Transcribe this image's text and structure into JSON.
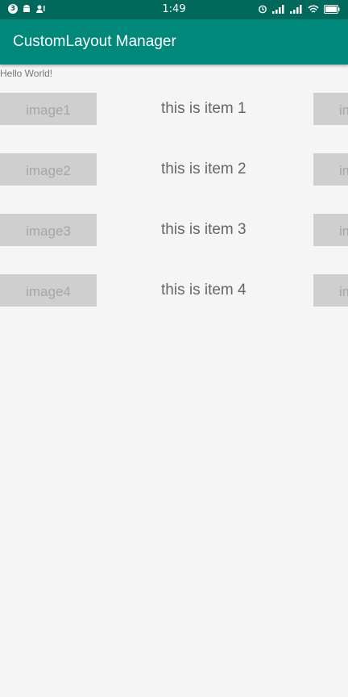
{
  "status_bar": {
    "notification_count": "3",
    "time": "1:49",
    "left_icons": [
      "android-icon",
      "person-icon"
    ],
    "right_icons": [
      "alarm-icon",
      "signal-icon",
      "signal-icon",
      "wifi-icon",
      "battery-icon"
    ]
  },
  "app_bar": {
    "title": "CustomLayout Manager"
  },
  "hello_text": "Hello World!",
  "items": [
    {
      "image_label": "image1",
      "text": "this is item 1",
      "right_label": "im"
    },
    {
      "image_label": "image2",
      "text": "this is item 2",
      "right_label": "im"
    },
    {
      "image_label": "image3",
      "text": "this is item 3",
      "right_label": "im"
    },
    {
      "image_label": "image4",
      "text": "this is item 4",
      "right_label": "im"
    }
  ],
  "colors": {
    "status_bar": "#00695c",
    "app_bar": "#00897b",
    "background": "#f5f5f5",
    "image_placeholder": "#cfcfcf"
  }
}
